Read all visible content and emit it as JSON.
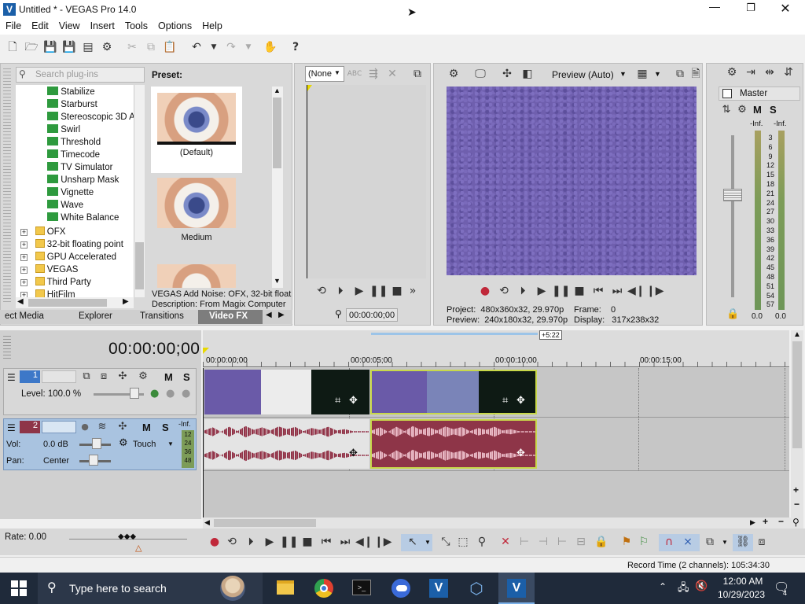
{
  "window": {
    "title": "Untitled * - VEGAS Pro 14.0"
  },
  "menu": [
    "File",
    "Edit",
    "View",
    "Insert",
    "Tools",
    "Options",
    "Help"
  ],
  "plugins": {
    "search_placeholder": "Search plug-ins",
    "items": [
      "Stabilize",
      "Starburst",
      "Stereoscopic 3D A",
      "Swirl",
      "Threshold",
      "Timecode",
      "TV Simulator",
      "Unsharp Mask",
      "Vignette",
      "Wave",
      "White Balance"
    ],
    "folders": [
      "OFX",
      "32-bit floating point",
      "GPU Accelerated",
      "VEGAS",
      "Third Party",
      "HitFilm"
    ]
  },
  "preset": {
    "label": "Preset:",
    "items": [
      "(Default)",
      "Medium"
    ],
    "desc1": "VEGAS Add Noise: OFX, 32-bit float",
    "desc2": "Description: From Magix Computer"
  },
  "tabs": [
    "ect Media",
    "Explorer",
    "Transitions",
    "Video FX"
  ],
  "trimmer": {
    "dropdown": "(None",
    "time": "00:00:00;00"
  },
  "preview": {
    "mode": "Preview (Auto)",
    "project": "Project:  480x360x32, 29.970p",
    "preview_res": "Preview:  240x180x32, 29.970p",
    "frame": "Frame:    0",
    "display": "Display:   317x238x32"
  },
  "master": {
    "label": "Master",
    "m": "M",
    "s": "S",
    "inf_l": "-Inf.",
    "inf_r": "-Inf.",
    "scale": [
      "3",
      "6",
      "9",
      "12",
      "15",
      "18",
      "21",
      "24",
      "27",
      "30",
      "33",
      "36",
      "39",
      "42",
      "45",
      "48",
      "51",
      "54",
      "57"
    ],
    "val_l": "0.0",
    "val_r": "0.0"
  },
  "timeline": {
    "time": "00:00:00;00",
    "loop": "+5:22",
    "ruler": [
      "00:00:00;00",
      "00:00:05;00",
      "00:00:10;00",
      "00:00:15;00"
    ]
  },
  "track1": {
    "num": "1",
    "m": "M",
    "s": "S",
    "level": "Level: 100.0 %"
  },
  "track2": {
    "num": "2",
    "m": "M",
    "s": "S",
    "vol": "Vol:",
    "vol_val": "0.0 dB",
    "pan": "Pan:",
    "pan_val": "Center",
    "touch": "Touch",
    "inf": "-Inf.",
    "meter": [
      "12",
      "24",
      "36",
      "48"
    ]
  },
  "rate": "Rate: 0.00",
  "status": "Record Time (2 channels): 105:34:30",
  "taskbar": {
    "search": "Type here to search",
    "time": "12:00 AM",
    "date": "10/29/2023",
    "badge": "4"
  },
  "colors": {
    "accent": "#3d78c8",
    "video": "#6a5aa8",
    "audio": "#8e3548",
    "selected": "#c8d84a"
  }
}
